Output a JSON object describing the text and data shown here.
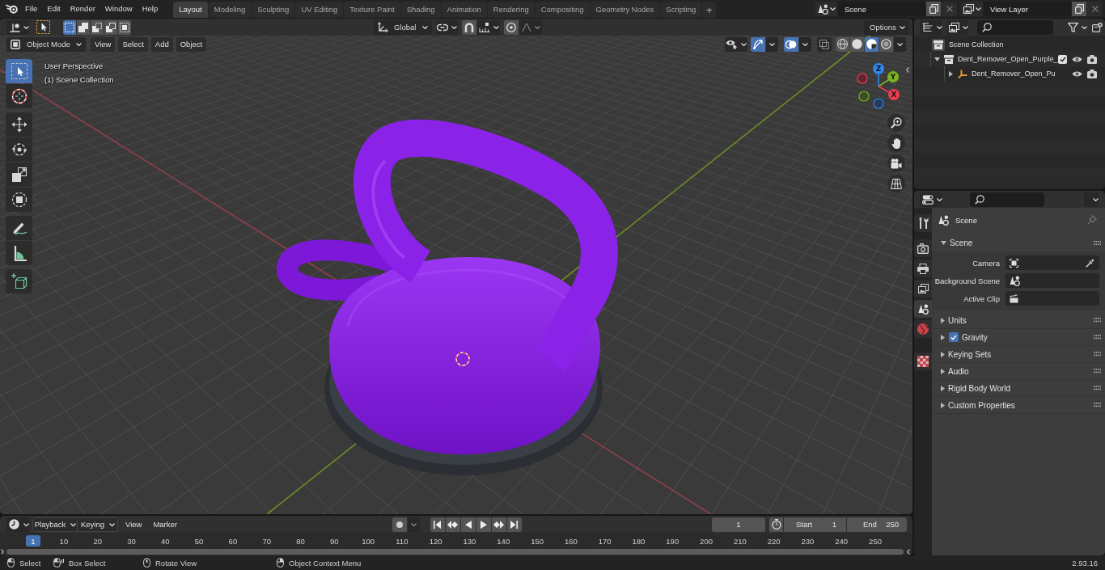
{
  "top_bar": {
    "menus": [
      "File",
      "Edit",
      "Render",
      "Window",
      "Help"
    ],
    "workspaces": [
      {
        "label": "Layout",
        "selected": true
      },
      {
        "label": "Modeling",
        "selected": false
      },
      {
        "label": "Sculpting",
        "selected": false
      },
      {
        "label": "UV Editing",
        "selected": false
      },
      {
        "label": "Texture Paint",
        "selected": false
      },
      {
        "label": "Shading",
        "selected": false
      },
      {
        "label": "Animation",
        "selected": false
      },
      {
        "label": "Rendering",
        "selected": false
      },
      {
        "label": "Compositing",
        "selected": false
      },
      {
        "label": "Geometry Nodes",
        "selected": false
      },
      {
        "label": "Scripting",
        "selected": false
      }
    ],
    "add_workspace": "+",
    "scene": "Scene",
    "view_layer": "View Layer"
  },
  "viewport": {
    "tool_header": {
      "select_modes": [
        {
          "selected": true
        },
        {
          "selected": false
        },
        {
          "selected": false
        },
        {
          "selected": false
        },
        {
          "selected": false
        }
      ],
      "orientation": "Global",
      "snap": false,
      "proportional_editing": false,
      "options": "Options"
    },
    "header": {
      "mode": "Object Mode",
      "menus": [
        "View",
        "Select",
        "Add",
        "Object"
      ],
      "gizmos": true,
      "overlays": true,
      "xray": false,
      "shading": [
        {
          "selected": false
        },
        {
          "selected": false
        },
        {
          "selected": true
        },
        {
          "selected": false
        }
      ]
    },
    "info": [
      "User Perspective",
      "(1) Scene Collection"
    ],
    "tools": [
      {
        "selected": true
      },
      {
        "selected": false
      },
      {
        "selected": false
      },
      {
        "selected": false
      },
      {
        "selected": false
      },
      {
        "selected": false
      },
      {
        "selected": false
      },
      {
        "selected": false
      },
      {
        "selected": false
      }
    ],
    "axes": [
      "Z",
      "Y",
      "X"
    ]
  },
  "outliner": {
    "tree": [
      {
        "label": "Scene Collection",
        "kind": "scene_collection",
        "children": [
          {
            "label": "Dent_Remover_Open_Purple_",
            "kind": "collection",
            "expanded": true,
            "checked": true,
            "children": [
              {
                "label": "Dent_Remover_Open_Pu",
                "kind": "empty",
                "expanded": false
              }
            ]
          }
        ]
      }
    ]
  },
  "properties": {
    "tabs": [
      {
        "selected": false
      },
      {
        "selected": false
      },
      {
        "selected": false
      },
      {
        "selected": false
      },
      {
        "selected": true
      },
      {
        "selected": false
      },
      {
        "selected": false
      }
    ],
    "context": "Scene",
    "panels": [
      {
        "label": "Scene",
        "expanded": true,
        "fields": [
          {
            "label": "Camera",
            "kind": "object"
          },
          {
            "label": "Background Scene",
            "kind": "scene"
          },
          {
            "label": "Active Clip",
            "kind": "clip"
          }
        ]
      },
      {
        "label": "Units",
        "expanded": false
      },
      {
        "label": "Gravity",
        "expanded": false,
        "checked": true
      },
      {
        "label": "Keying Sets",
        "expanded": false
      },
      {
        "label": "Audio",
        "expanded": false
      },
      {
        "label": "Rigid Body World",
        "expanded": false
      },
      {
        "label": "Custom Properties",
        "expanded": false
      }
    ]
  },
  "timeline": {
    "menus": [
      {
        "label": "Playback",
        "kind": "dropdown"
      },
      {
        "label": "Keying",
        "kind": "dropdown"
      },
      {
        "label": "View",
        "kind": "menu"
      },
      {
        "label": "Marker",
        "kind": "menu"
      }
    ],
    "auto_keying": false,
    "current_frame": "1",
    "start": {
      "label": "Start",
      "value": "1"
    },
    "end": {
      "label": "End",
      "value": "250"
    },
    "playhead": "1",
    "ticks": [
      "10",
      "20",
      "30",
      "40",
      "50",
      "60",
      "70",
      "80",
      "90",
      "100",
      "110",
      "120",
      "130",
      "140",
      "150",
      "160",
      "170",
      "180",
      "190",
      "200",
      "210",
      "220",
      "230",
      "240",
      "250"
    ]
  },
  "status_bar": {
    "hints": [
      {
        "label": "Select",
        "kind": "left"
      },
      {
        "label": "Box Select",
        "kind": "drag"
      },
      {
        "label": "Rotate View",
        "kind": "middle"
      },
      {
        "label": "Object Context Menu",
        "kind": "right"
      }
    ],
    "version": "2.93.16"
  }
}
